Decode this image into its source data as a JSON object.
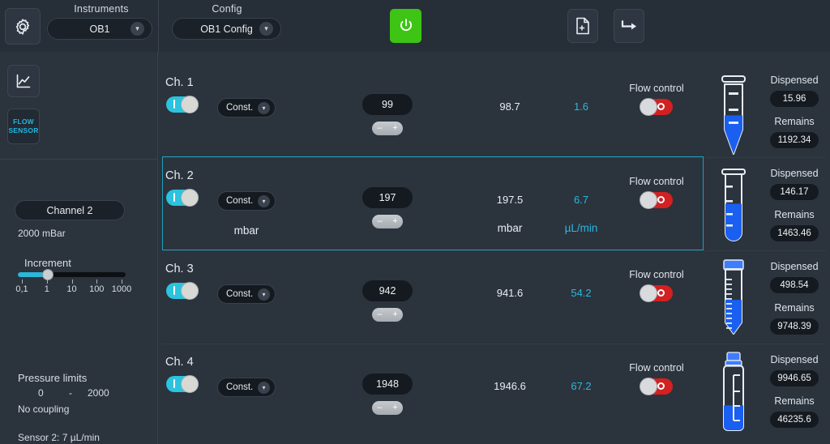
{
  "topbar": {
    "gear_icon": "gear-icon",
    "instruments_label": "Instruments",
    "instrument_value": "OB1",
    "config_label": "Config",
    "config_value": "OB1 Config",
    "power_icon": "power-icon",
    "new_file_icon": "new-document-icon",
    "export_icon": "arrow-export-icon"
  },
  "sidebar": {
    "chart_icon": "chart-icon",
    "flow_sensor_line1": "FLOW",
    "flow_sensor_line2": "SENSOR",
    "channel_name": "Channel 2",
    "channel_range": "2000 mBar",
    "increment_label": "Increment",
    "increment_ticks": [
      "0,1",
      "1",
      "10",
      "100",
      "1000"
    ],
    "increment_thumb_percent": 28,
    "pressure_limits_label": "Pressure limits",
    "pressure_min": "0",
    "pressure_dash": "-",
    "pressure_max": "2000",
    "coupling": "No coupling",
    "sensor_info": "Sensor 2: 7 µL/min"
  },
  "channels": [
    {
      "name": "Ch. 1",
      "enabled": true,
      "mode": "Const.",
      "setpoint": "99",
      "minus": "–",
      "plus": "+",
      "measured": "98.7",
      "flow": "1.6",
      "pressure_unit": "",
      "flow_unit": "",
      "flow_control_label": "Flow control",
      "flow_control_on": false,
      "vial_type": "eppendorf",
      "fill_percent": 62,
      "dispensed_label": "Dispensed",
      "dispensed": "15.96",
      "remains_label": "Remains",
      "remains": "1192.34",
      "selected": false
    },
    {
      "name": "Ch. 2",
      "enabled": true,
      "mode": "Const.",
      "setpoint": "197",
      "minus": "–",
      "plus": "+",
      "measured": "197.5",
      "flow": "6.7",
      "pressure_unit": "mbar",
      "flow_unit": "µL/min",
      "flow_control_label": "Flow control",
      "flow_control_on": false,
      "vial_type": "testtube",
      "fill_percent": 62,
      "dispensed_label": "Dispensed",
      "dispensed": "146.17",
      "remains_label": "Remains",
      "remains": "1463.46",
      "selected": true
    },
    {
      "name": "Ch. 3",
      "enabled": true,
      "mode": "Const.",
      "setpoint": "942",
      "minus": "–",
      "plus": "+",
      "measured": "941.6",
      "flow": "54.2",
      "pressure_unit": "",
      "flow_unit": "",
      "flow_control_label": "Flow control",
      "flow_control_on": false,
      "vial_type": "falcon",
      "fill_percent": 57,
      "dispensed_label": "Dispensed",
      "dispensed": "498.54",
      "remains_label": "Remains",
      "remains": "9748.39",
      "selected": false
    },
    {
      "name": "Ch. 4",
      "enabled": true,
      "mode": "Const.",
      "setpoint": "1948",
      "minus": "–",
      "plus": "+",
      "measured": "1946.6",
      "flow": "67.2",
      "pressure_unit": "",
      "flow_unit": "",
      "flow_control_label": "Flow control",
      "flow_control_on": false,
      "vial_type": "bottle",
      "fill_percent": 41,
      "dispensed_label": "Dispensed",
      "dispensed": "9946.65",
      "remains_label": "Remains",
      "remains": "46235.6",
      "selected": false
    }
  ],
  "colors": {
    "background": "#2b333d",
    "topbar": "#262e37",
    "accent_cyan": "#2bc3dd",
    "power_green": "#3ec414",
    "toggle_off_red": "#d32020",
    "liquid_blue": "#1a5ff0",
    "selection_border": "#1f9fba"
  }
}
